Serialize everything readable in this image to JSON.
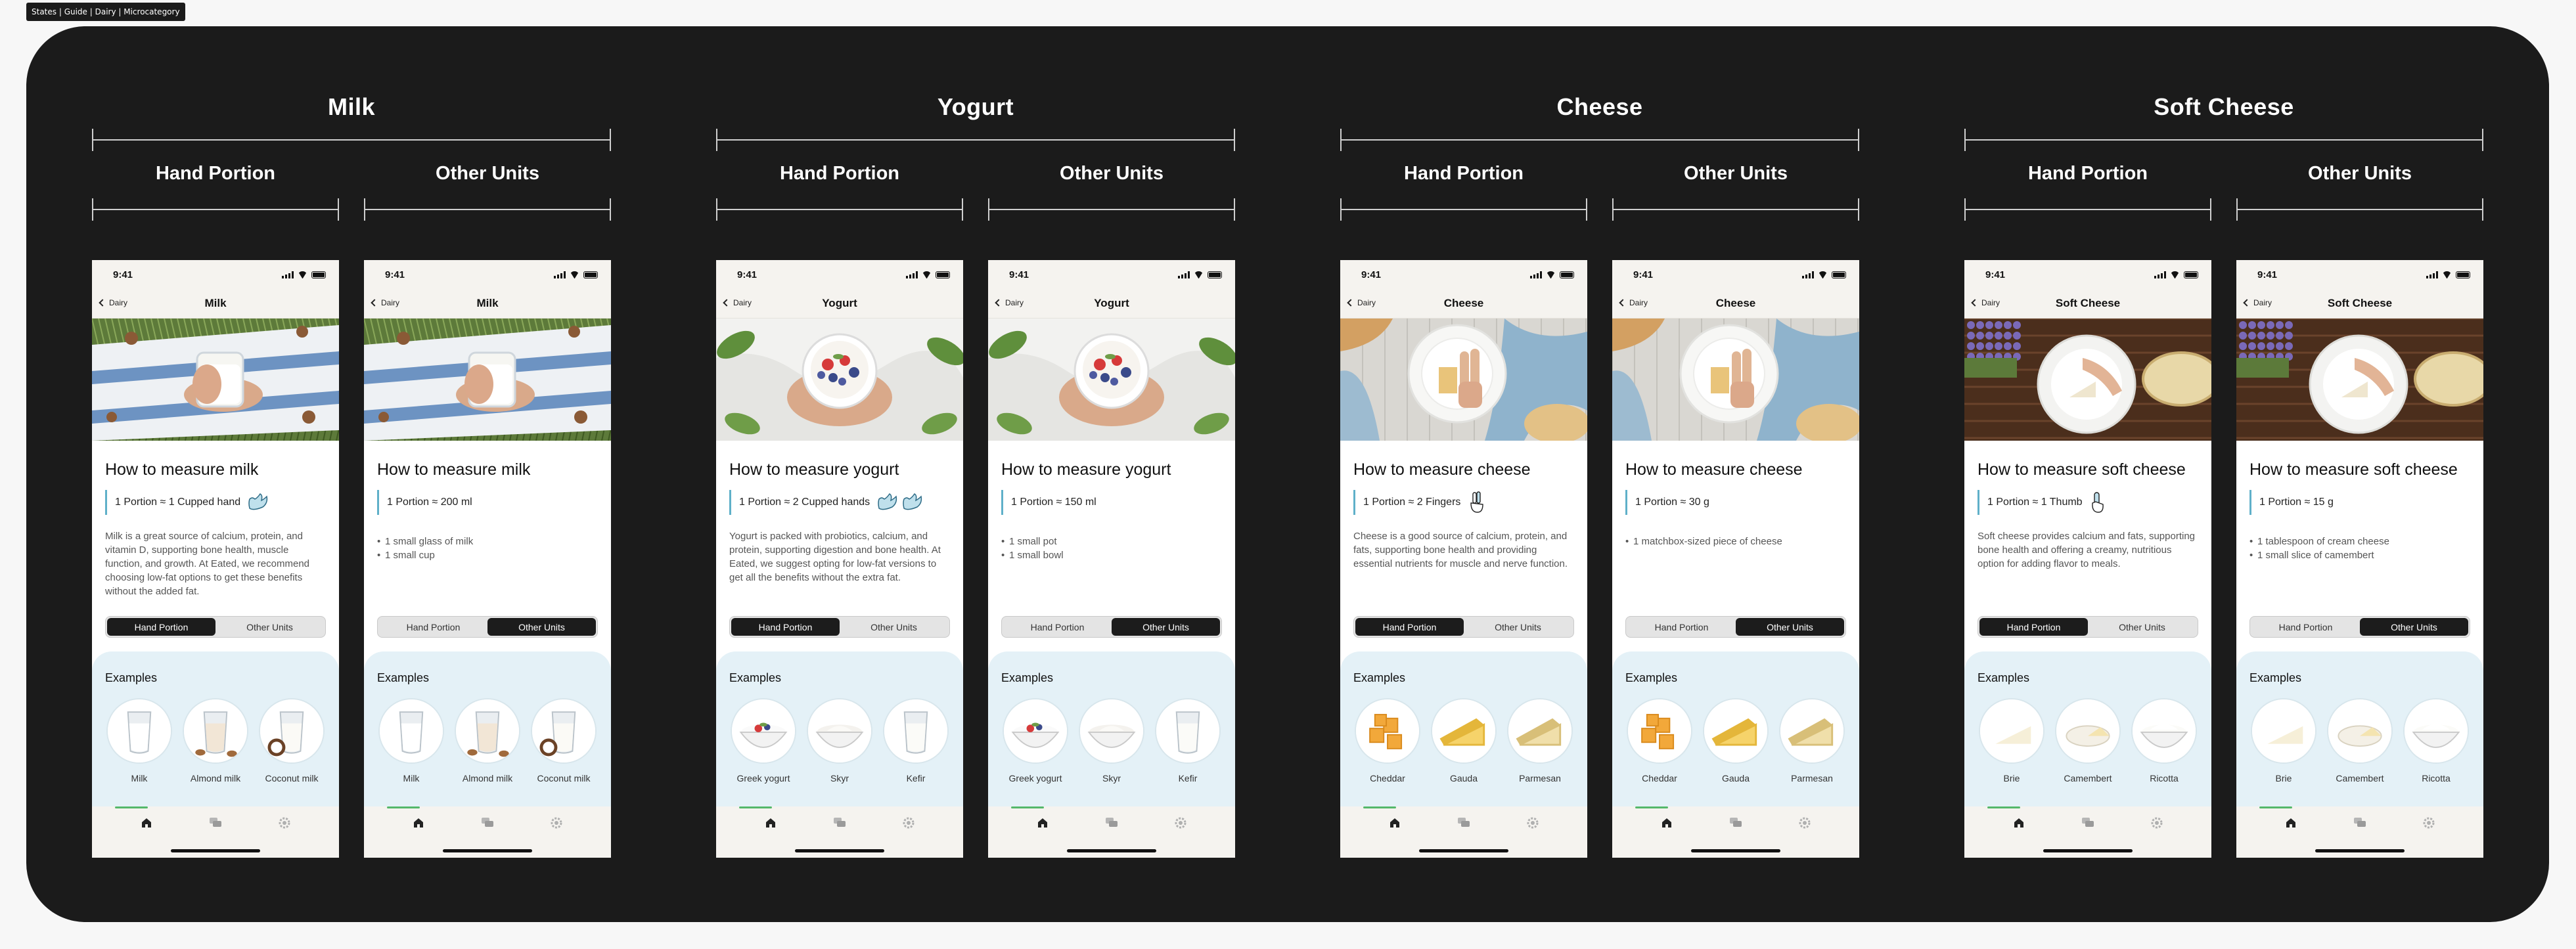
{
  "tag": "States | Guide | Dairy | Microcategory",
  "status_time": "9:41",
  "back_label": "Dairy",
  "toggle": {
    "hand": "Hand Portion",
    "other": "Other Units"
  },
  "examples_title": "Examples",
  "colors": {
    "board": "#1b1b1b",
    "accent": "#5fb0c9",
    "examples_bg": "#e4f1f7",
    "tab_indicator": "#55b86a"
  },
  "groups": [
    {
      "title": "Milk",
      "sub": [
        "Hand Portion",
        "Other Units"
      ],
      "nav_title": "Milk",
      "heading": "How to measure milk",
      "hand_portion": "1 Portion ≈ 1 Cupped hand",
      "hand_text": "Milk is a great source of calcium, protein, and vitamin D, supporting bone health, muscle function, and growth. At Eated, we recommend choosing low-fat options to get these benefits without the added fat.",
      "other_portion": "1 Portion ≈ 200 ml",
      "other_bullets": [
        "1 small glass of milk",
        "1 small cup"
      ],
      "examples": [
        "Milk",
        "Almond milk",
        "Coconut milk"
      ],
      "hero": "milk-hero",
      "hand_icon": "cupped-hand-icon"
    },
    {
      "title": "Yogurt",
      "sub": [
        "Hand Portion",
        "Other Units"
      ],
      "nav_title": "Yogurt",
      "heading": "How to measure yogurt",
      "hand_portion": "1 Portion ≈ 2 Cupped hands",
      "hand_text": "Yogurt is packed with probiotics, calcium, and protein, supporting digestion and bone health. At Eated, we suggest opting for low-fat versions to get all the benefits without the extra fat.",
      "other_portion": "1 Portion ≈ 150 ml",
      "other_bullets": [
        "1 small pot",
        "1 small bowl"
      ],
      "examples": [
        "Greek yogurt",
        "Skyr",
        "Kefir"
      ],
      "hero": "yogurt-hero",
      "hand_icon": "two-cupped-hands-icon"
    },
    {
      "title": "Cheese",
      "sub": [
        "Hand Portion",
        "Other Units"
      ],
      "nav_title": "Cheese",
      "heading": "How to measure cheese",
      "hand_portion": "1 Portion ≈ 2 Fingers",
      "hand_text": "Cheese is a good source of calcium, protein, and fats, supporting bone health and providing essential nutrients for muscle and nerve function.",
      "other_portion": "1 Portion ≈ 30 g",
      "other_bullets": [
        "1 matchbox-sized piece of cheese"
      ],
      "examples": [
        "Cheddar",
        "Gauda",
        "Parmesan"
      ],
      "hero": "cheese-hero",
      "hand_icon": "two-fingers-icon"
    },
    {
      "title": "Soft Cheese",
      "sub": [
        "Hand Portion",
        "Other Units"
      ],
      "nav_title": "Soft Cheese",
      "heading": "How to measure soft cheese",
      "hand_portion": "1 Portion ≈ 1 Thumb",
      "hand_text": "Soft cheese provides calcium and fats, supporting bone health and offering a creamy, nutritious option for adding flavor to meals.",
      "other_portion": "1 Portion ≈ 15 g",
      "other_bullets": [
        "1 tablespoon of cream cheese",
        "1 small slice of camembert"
      ],
      "examples": [
        "Brie",
        "Camembert",
        "Ricotta"
      ],
      "hero": "soft-cheese-hero",
      "hand_icon": "thumb-icon"
    }
  ]
}
